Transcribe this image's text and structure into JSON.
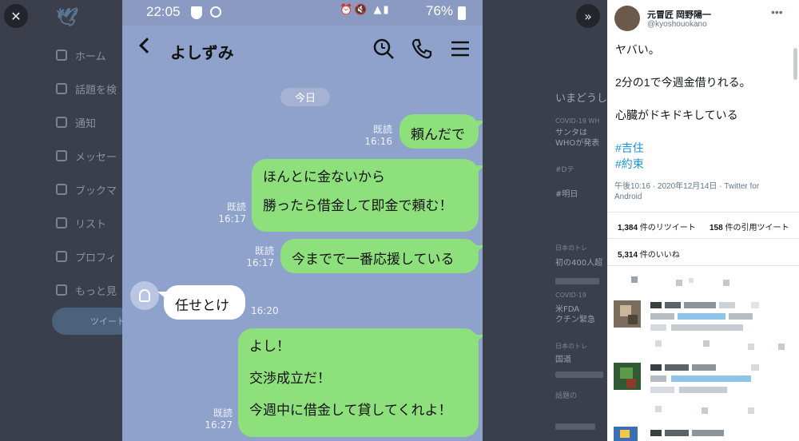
{
  "viewer": {
    "close_glyph": "✕",
    "next_glyph": "»"
  },
  "background": {
    "logo": "",
    "nav": [
      "ホーム",
      "話題を検",
      "通知",
      "メッセー",
      "ブックマ",
      "リスト",
      "プロフィ",
      "もっと見"
    ],
    "tweet_button": "ツイート",
    "right_texts": [
      "いまどうし",
      "COVID-19 WH",
      "サンタは",
      "WHOが発表",
      "#Dテ",
      "#明日",
      "日本のトレ",
      "初の400人超",
      "COVID-19",
      "米FDA",
      "クチン緊急",
      "日本のトレ",
      "国道",
      "話題の"
    ]
  },
  "phone": {
    "status": {
      "time": "22:05",
      "battery": "76%"
    },
    "chat_title": "よしずみ",
    "date_label": "今日",
    "icons": [
      "back-icon",
      "search-icon",
      "phone-icon",
      "menu-icon"
    ],
    "messages": [
      {
        "side": "me",
        "lines": [
          "頼んだで"
        ],
        "read": "既読",
        "time": "16:16"
      },
      {
        "side": "me",
        "lines": [
          "ほんとに金ないから",
          "勝ったら借金して即金で頼む！"
        ],
        "read": "既読",
        "time": "16:17"
      },
      {
        "side": "me",
        "lines": [
          "今までで一番応援している"
        ],
        "read": "既読",
        "time": "16:17"
      },
      {
        "side": "them",
        "lines": [
          "任せとけ"
        ],
        "time": "16:20"
      },
      {
        "side": "me",
        "lines": [
          "よし！",
          "交渉成立だ！",
          "今週中に借金して貸してくれよ！"
        ],
        "read": "既読",
        "time": "16:27"
      }
    ]
  },
  "tweet": {
    "author": "元冒匠 岡野陽一",
    "handle": "@kyoshouokano",
    "more": "•••",
    "body": [
      "ヤバい。",
      "2分の1で今週金借りれる。",
      "心臓がドキドキしている"
    ],
    "hashtags": [
      "#吉住",
      "#約束"
    ],
    "timestamp": "午後10:16 · 2020年12月14日 · Twitter for Android",
    "retweets": {
      "count": "1,384",
      "label": "件のリツイート"
    },
    "quotes": {
      "count": "158",
      "label": "件の引用ツイート"
    },
    "likes": {
      "count": "5,314",
      "label": "件のいいね"
    }
  },
  "colors": {
    "chat_bg": "#8ea2cc",
    "my_bubble": "#8de07c",
    "their_bubble": "#ffffff",
    "hashtag": "#1b95e0"
  }
}
